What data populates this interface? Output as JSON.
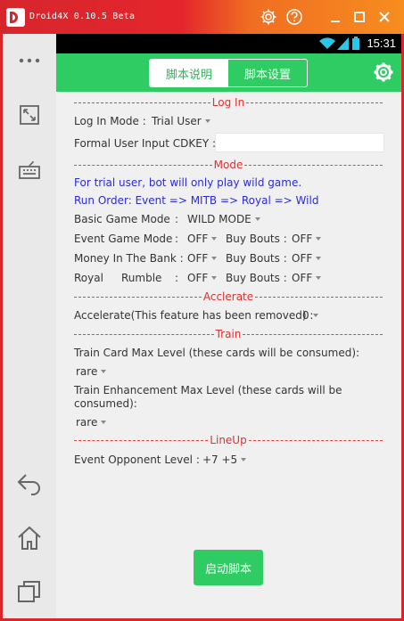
{
  "window": {
    "title": "Droid4X 0.10.5 Beta",
    "controls": [
      "gear-icon",
      "help-icon",
      "minimize-icon",
      "maximize-icon",
      "close-icon"
    ]
  },
  "sidebar": {
    "icons": [
      "more-icon",
      "fullscreen-icon",
      "keyboard-icon",
      "back-icon",
      "home-icon",
      "recent-apps-icon"
    ]
  },
  "statusbar": {
    "time": "15:31"
  },
  "tabs": [
    {
      "label": "脚本说明",
      "active": true
    },
    {
      "label": "脚本设置",
      "active": false
    }
  ],
  "sections": {
    "login": "Log In",
    "mode": "Mode",
    "accelerate": "Acclerate",
    "train": "Train",
    "lineup": "LineUp"
  },
  "login": {
    "mode_label": "Log In Mode :",
    "mode_value": "Trial User",
    "cdkey_label": "Formal User Input CDKEY :",
    "cdkey_value": ""
  },
  "mode": {
    "notice": "For trial user, bot will only play wild game.",
    "run_order": "Run Order:  Event => MITB => Royal => Wild",
    "basic_label": "Basic Game Mode",
    "basic_colon": ":",
    "basic_value": "WILD MODE",
    "event_label": "Event Game Mode",
    "event_colon": ":",
    "event_value": "OFF",
    "event_bouts_label": "Buy Bouts :",
    "event_bouts_value": "OFF",
    "bank_label": "Money In The Bank :",
    "bank_value": "OFF",
    "bank_bouts_label": "Buy Bouts :",
    "bank_bouts_value": "OFF",
    "royal_label_1": "Royal",
    "royal_label_2": "Rumble",
    "royal_colon": ":",
    "royal_value": "OFF",
    "royal_bouts_label": "Buy Bouts :",
    "royal_bouts_value": "OFF"
  },
  "accelerate": {
    "label": "Accelerate(This feature has been removed) :",
    "value": "0"
  },
  "train": {
    "card_label": "Train Card Max Level (these cards will be consumed):",
    "card_value": "rare",
    "enh_label_line1": "Train Enhancement Max Level (these cards will be",
    "enh_label_line2": "consumed):",
    "enh_value": "rare"
  },
  "lineup": {
    "label": "Event Opponent Level :",
    "value": "+7 +5"
  },
  "start_button": "启动脚本",
  "colors": {
    "accent_green": "#2fcb63",
    "frame_red": "#d8262b",
    "divider_red": "#e03030",
    "notice_blue": "#2b2bd8"
  }
}
